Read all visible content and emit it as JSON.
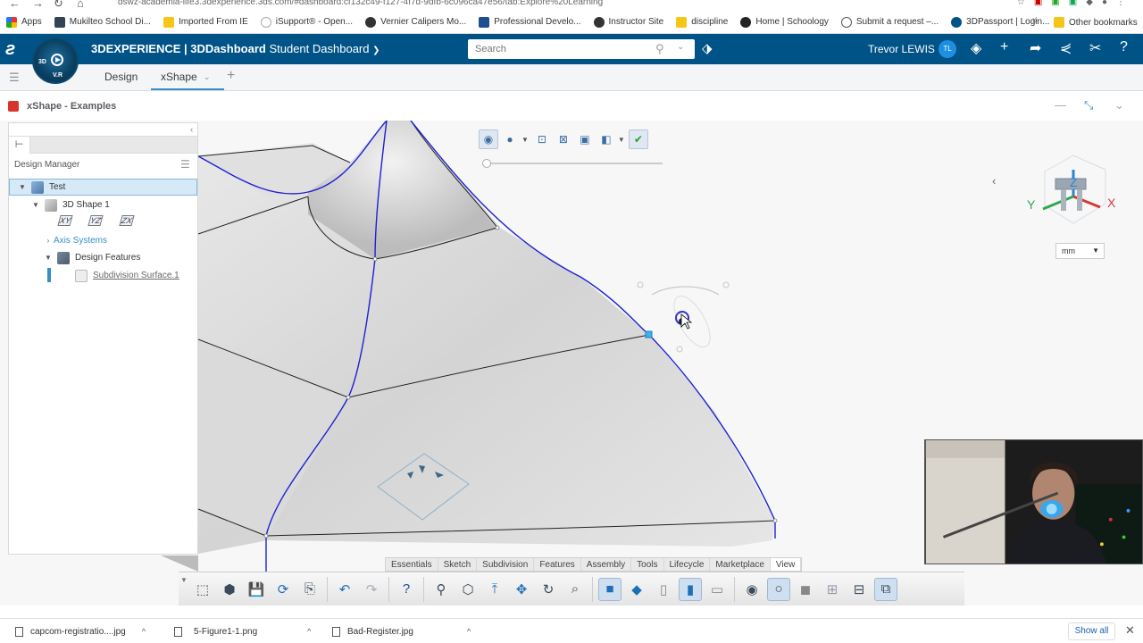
{
  "browser": {
    "url": "dswz-academia-life3.3dexperience.3ds.com/#dashboard:cf132c49-f127-4f7d-9dfb-6c096ca47e56/tab:Explore%20Learning"
  },
  "bookmarks": [
    {
      "label": "Apps",
      "icon": "apps-grid-icon"
    },
    {
      "label": "Mukilteo School Di...",
      "icon": "school-icon"
    },
    {
      "label": "Imported From IE",
      "icon": "folder-icon"
    },
    {
      "label": "iSupport® - Open...",
      "icon": "bulb-icon"
    },
    {
      "label": "Vernier Calipers Mo...",
      "icon": "globe-icon"
    },
    {
      "label": "Professional Develo...",
      "icon": "p-icon"
    },
    {
      "label": "Instructor Site",
      "icon": "globe-icon"
    },
    {
      "label": "discipline",
      "icon": "folder-icon"
    },
    {
      "label": "Home | Schoology",
      "icon": "schoology-icon"
    },
    {
      "label": "Submit a request –...",
      "icon": "s-icon"
    },
    {
      "label": "3DPassport | Login...",
      "icon": "ds-icon"
    }
  ],
  "bookmarks_other": "Other bookmarks",
  "topbar": {
    "brand": "3DEXPERIENCE",
    "separator": " | ",
    "dashboard": "3DDashboard",
    "dashboard_name": "Student Dashboard",
    "search_placeholder": "Search",
    "user_name": "Trevor LEWIS",
    "user_initials": "TL",
    "compass_label": "V.R",
    "compass_3d": "3D"
  },
  "tabs": [
    {
      "label": "Design",
      "active": false
    },
    {
      "label": "xShape",
      "active": true
    }
  ],
  "app": {
    "title": "xShape - Examples"
  },
  "design_manager": {
    "title": "Design Manager",
    "tree": {
      "root": "Test",
      "shape": "3D Shape 1",
      "planes": [
        "XY",
        "YZ",
        "ZX"
      ],
      "axis_systems": "Axis Systems",
      "design_features": "Design Features",
      "feature": "Subdivision Surface.1"
    }
  },
  "units": {
    "selected": "mm"
  },
  "gizmo_axes": {
    "x": "X",
    "y": "Y",
    "z": "Z"
  },
  "section_tabs": [
    "Essentials",
    "Sketch",
    "Subdivision",
    "Features",
    "Assembly",
    "Tools",
    "Lifecycle",
    "Marketplace",
    "View"
  ],
  "active_section": "View",
  "downloads": [
    {
      "name": "capcom-registratio....jpg"
    },
    {
      "name": "5-Figure1-1.png"
    },
    {
      "name": "Bad-Register.jpg"
    }
  ],
  "downloads_show_all": "Show all",
  "colors": {
    "topbar": "#005386",
    "accent": "#368ec4",
    "curve_blue": "#1f1fd6"
  }
}
